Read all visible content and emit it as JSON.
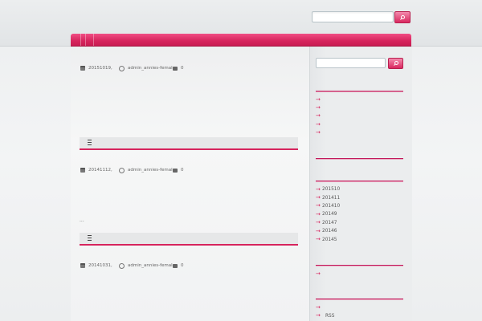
{
  "posts": [
    {
      "date": "20151019,",
      "author": "admin_annies-female,",
      "comments": "0"
    },
    {
      "date": "20141112,",
      "author": "admin_annies-female,",
      "comments": "0"
    },
    {
      "date": "20141031,",
      "author": "admin_annies-female,",
      "comments": "0"
    }
  ],
  "more_text": "...",
  "sidebar": {
    "arrow": "→",
    "recent_items": [
      "",
      "",
      "",
      "",
      ""
    ],
    "archives": [
      "201510",
      "201411",
      "201410",
      "20149",
      "20147",
      "20146",
      "20145"
    ],
    "category_items": [
      ""
    ],
    "meta_items": [
      "",
      "RSS"
    ]
  },
  "colors": {
    "accent": "#d6245d",
    "accent_light": "#f04d84"
  }
}
